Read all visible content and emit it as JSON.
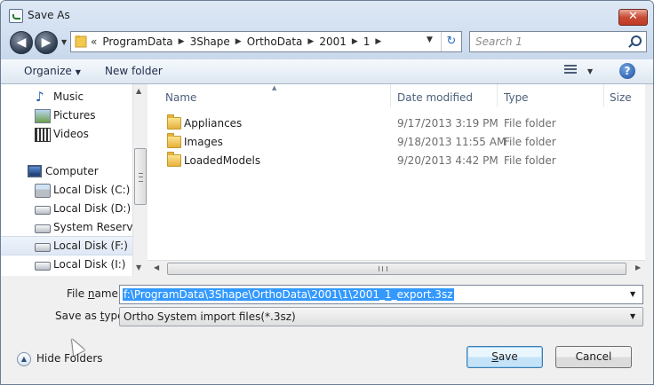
{
  "window": {
    "title": "Save As",
    "close_label": "✕"
  },
  "nav": {
    "back_label": "◀",
    "forward_label": "▶",
    "dropdown_arrow": "▼"
  },
  "address": {
    "overflow": "«",
    "sep": "▶",
    "crumbs": [
      "ProgramData",
      "3Shape",
      "OrthoData",
      "2001",
      "1"
    ],
    "dropdown_arrow": "▼",
    "refresh_label": "↻"
  },
  "search": {
    "placeholder": "Search 1"
  },
  "toolbar": {
    "organize_label": "Organize",
    "organize_arrow": "▼",
    "new_folder_label": "New folder",
    "view_arrow": "▼",
    "help_label": "?"
  },
  "navpane": {
    "items": [
      {
        "label": "Music",
        "icon": "music-icon"
      },
      {
        "label": "Pictures",
        "icon": "pictures-icon"
      },
      {
        "label": "Videos",
        "icon": "videos-icon"
      },
      {
        "label": "Computer",
        "icon": "computer-icon"
      },
      {
        "label": "Local Disk (C:)",
        "icon": "windows-disk-icon"
      },
      {
        "label": "Local Disk (D:)",
        "icon": "disk-icon"
      },
      {
        "label": "System Reserved",
        "icon": "disk-icon"
      },
      {
        "label": "Local Disk (F:)",
        "icon": "disk-icon",
        "selected": true
      },
      {
        "label": "Local Disk (I:)",
        "icon": "disk-icon"
      }
    ],
    "scroll_up": "▲",
    "scroll_down": "▼"
  },
  "files": {
    "columns": [
      "Name",
      "Date modified",
      "Type",
      "Size"
    ],
    "sort_arrow": "▲",
    "rows": [
      {
        "name": "Appliances",
        "date": "9/17/2013 3:19 PM",
        "type": "File folder"
      },
      {
        "name": "Images",
        "date": "9/18/2013 11:55 AM",
        "type": "File folder"
      },
      {
        "name": "LoadedModels",
        "date": "9/20/2013 4:42 PM",
        "type": "File folder"
      }
    ],
    "scroll_left": "◀",
    "scroll_right": "▶"
  },
  "form": {
    "filename_label_pre": "File ",
    "filename_label_u": "n",
    "filename_label_post": "ame:",
    "filename_value": "f:\\ProgramData\\3Shape\\OrthoData\\2001\\1\\2001_1_export.3sz",
    "savetype_label_pre": "Save as ",
    "savetype_label_u": "t",
    "savetype_label_post": "ype:",
    "savetype_value": "Ortho System import files(*.3sz)",
    "dropdown_arrow": "▼"
  },
  "footer": {
    "hide_folders_label": "Hide Folders",
    "hide_folders_arrow": "▲",
    "save_label_u": "S",
    "save_label_post": "ave",
    "cancel_label": "Cancel"
  }
}
